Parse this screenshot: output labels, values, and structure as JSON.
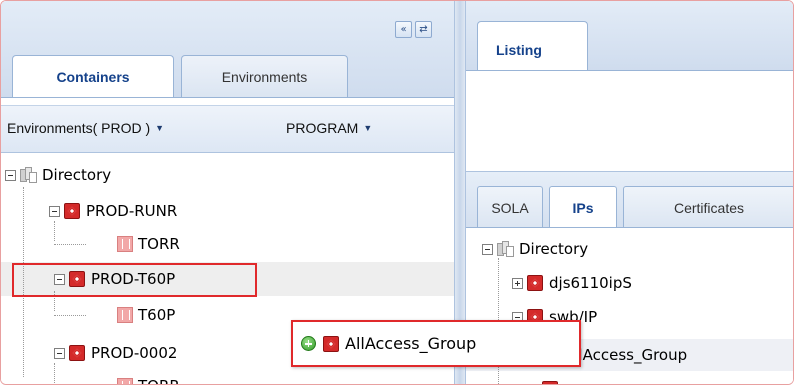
{
  "left_panel": {
    "collapse_buttons": [
      "«",
      "⇄"
    ],
    "tabs": [
      {
        "label": "Containers",
        "active": true
      },
      {
        "label": "Environments",
        "active": false
      }
    ],
    "toolbar": {
      "env_menu": "Environments( PROD )",
      "program_menu": "PROGRAM",
      "dropdown_arrow": "▼"
    },
    "tree": {
      "root": "Directory",
      "nodes": [
        {
          "label": "PROD-RUNR",
          "icon": "red-container-icon",
          "children": [
            "TORR"
          ]
        },
        {
          "label": "PROD-T60P",
          "icon": "red-container-icon",
          "children": [
            "T60P"
          ],
          "highlighted": true
        },
        {
          "label": "PROD-0002",
          "icon": "red-container-icon",
          "children": [
            "TORR"
          ]
        }
      ]
    }
  },
  "right_panel": {
    "top_tab": "Listing",
    "sub_tabs": [
      {
        "label": "SOLA",
        "active": false
      },
      {
        "label": "IPs",
        "active": true
      },
      {
        "label": "Certificates",
        "active": false
      }
    ],
    "tree": {
      "root": "Directory",
      "nodes": [
        "djs6110ipS",
        "swb/IP",
        "AllAccess_Group"
      ]
    }
  },
  "drag_proxy": {
    "label": "AllAccess_Group",
    "status_icon": "add-icon"
  },
  "colors": {
    "highlight_border": "#e0292b",
    "tab_active_text": "#15428b",
    "header_bg": "#d6e3f3"
  }
}
